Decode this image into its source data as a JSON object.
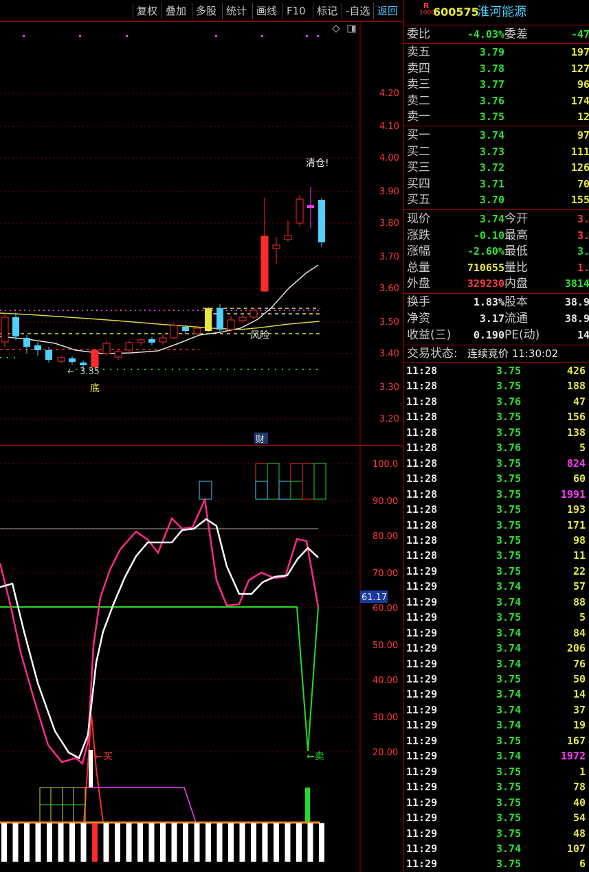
{
  "toolbar": {
    "buttons": [
      "复权",
      "叠加",
      "多股",
      "统计",
      "画线",
      "F10",
      "标记",
      "-自选",
      "返回"
    ]
  },
  "main_chart": {
    "price_axis": [
      "4.20",
      "4.10",
      "4.00",
      "3.90",
      "3.80",
      "3.70",
      "3.60",
      "3.50",
      "3.40",
      "3.30",
      "3.20"
    ],
    "indicator_axis": [
      "100.0",
      "90.00",
      "80.00",
      "70.00",
      "60.00",
      "50.00",
      "40.00",
      "30.00",
      "20.00"
    ],
    "labels": {
      "clear": "清仓!",
      "risk": "风险",
      "bottom": "底",
      "low_price": "3.35",
      "finance": "财",
      "buy": "买",
      "sell": "←卖",
      "current_indicator": "61.17"
    }
  },
  "quote": {
    "market_badge_top": "R",
    "market_badge_bottom": "1000",
    "code": "600575",
    "name": "淮河能源",
    "ratio_label": "委比",
    "ratio_value": "-4.03%",
    "diff_label": "委差",
    "diff_value": "-47",
    "asks": [
      {
        "label": "卖五",
        "price": "3.79",
        "vol": "197"
      },
      {
        "label": "卖四",
        "price": "3.78",
        "vol": "127"
      },
      {
        "label": "卖三",
        "price": "3.77",
        "vol": "96"
      },
      {
        "label": "卖二",
        "price": "3.76",
        "vol": "174"
      },
      {
        "label": "卖一",
        "price": "3.75",
        "vol": "12"
      }
    ],
    "bids": [
      {
        "label": "买一",
        "price": "3.74",
        "vol": "97"
      },
      {
        "label": "买二",
        "price": "3.73",
        "vol": "111"
      },
      {
        "label": "买三",
        "price": "3.72",
        "vol": "126"
      },
      {
        "label": "买四",
        "price": "3.71",
        "vol": "70"
      },
      {
        "label": "买五",
        "price": "3.70",
        "vol": "155"
      }
    ],
    "stats": [
      {
        "l1": "现价",
        "v1": "3.74",
        "c1": "green",
        "l2": "今开",
        "v2": "3.",
        "c2": "red"
      },
      {
        "l1": "涨跌",
        "v1": "-0.10",
        "c1": "green",
        "l2": "最高",
        "v2": "3.",
        "c2": "red"
      },
      {
        "l1": "涨幅",
        "v1": "-2.60%",
        "c1": "green",
        "l2": "最低",
        "v2": "3.",
        "c2": "green"
      },
      {
        "l1": "总量",
        "v1": "710655",
        "c1": "yellow",
        "l2": "量比",
        "v2": "1.",
        "c2": "red"
      },
      {
        "l1": "外盘",
        "v1": "329230",
        "c1": "red",
        "l2": "内盘",
        "v2": "3814",
        "c2": "green"
      }
    ],
    "fundamentals": [
      {
        "l1": "换手",
        "v1": "1.83%",
        "l2": "股本",
        "v2": "38.9"
      },
      {
        "l1": "净资",
        "v1": "3.17",
        "l2": "流通",
        "v2": "38.9"
      },
      {
        "l1": "收益(三)",
        "v1": "0.190",
        "l2": "PE(动)",
        "v2": "14"
      }
    ],
    "status_label": "交易状态:",
    "status_value": "连续竞价 11:30:02",
    "ticks": [
      {
        "t": "11:28",
        "p": "3.75",
        "v": "426",
        "pc": "green",
        "vc": "yellow"
      },
      {
        "t": "11:28",
        "p": "3.75",
        "v": "188",
        "pc": "green",
        "vc": "yellow"
      },
      {
        "t": "11:28",
        "p": "3.76",
        "v": "47",
        "pc": "green",
        "vc": "yellow"
      },
      {
        "t": "11:28",
        "p": "3.75",
        "v": "156",
        "pc": "green",
        "vc": "yellow"
      },
      {
        "t": "11:28",
        "p": "3.75",
        "v": "138",
        "pc": "green",
        "vc": "yellow"
      },
      {
        "t": "11:28",
        "p": "3.76",
        "v": "5",
        "pc": "green",
        "vc": "yellow"
      },
      {
        "t": "11:28",
        "p": "3.75",
        "v": "824",
        "pc": "green",
        "vc": "magenta"
      },
      {
        "t": "11:28",
        "p": "3.75",
        "v": "60",
        "pc": "green",
        "vc": "yellow"
      },
      {
        "t": "11:28",
        "p": "3.75",
        "v": "1991",
        "pc": "green",
        "vc": "magenta"
      },
      {
        "t": "11:28",
        "p": "3.75",
        "v": "193",
        "pc": "green",
        "vc": "yellow"
      },
      {
        "t": "11:28",
        "p": "3.75",
        "v": "171",
        "pc": "green",
        "vc": "yellow"
      },
      {
        "t": "11:28",
        "p": "3.75",
        "v": "98",
        "pc": "green",
        "vc": "yellow"
      },
      {
        "t": "11:28",
        "p": "3.75",
        "v": "11",
        "pc": "green",
        "vc": "yellow"
      },
      {
        "t": "11:29",
        "p": "3.75",
        "v": "22",
        "pc": "green",
        "vc": "yellow"
      },
      {
        "t": "11:29",
        "p": "3.74",
        "v": "57",
        "pc": "green",
        "vc": "yellow"
      },
      {
        "t": "11:29",
        "p": "3.74",
        "v": "88",
        "pc": "green",
        "vc": "yellow"
      },
      {
        "t": "11:29",
        "p": "3.75",
        "v": "5",
        "pc": "green",
        "vc": "yellow"
      },
      {
        "t": "11:29",
        "p": "3.74",
        "v": "84",
        "pc": "green",
        "vc": "yellow"
      },
      {
        "t": "11:29",
        "p": "3.74",
        "v": "206",
        "pc": "green",
        "vc": "yellow"
      },
      {
        "t": "11:29",
        "p": "3.74",
        "v": "76",
        "pc": "green",
        "vc": "yellow"
      },
      {
        "t": "11:29",
        "p": "3.75",
        "v": "50",
        "pc": "green",
        "vc": "yellow"
      },
      {
        "t": "11:29",
        "p": "3.74",
        "v": "14",
        "pc": "green",
        "vc": "yellow"
      },
      {
        "t": "11:29",
        "p": "3.74",
        "v": "37",
        "pc": "green",
        "vc": "yellow"
      },
      {
        "t": "11:29",
        "p": "3.74",
        "v": "19",
        "pc": "green",
        "vc": "yellow"
      },
      {
        "t": "11:29",
        "p": "3.75",
        "v": "167",
        "pc": "green",
        "vc": "yellow"
      },
      {
        "t": "11:29",
        "p": "3.74",
        "v": "1972",
        "pc": "green",
        "vc": "magenta"
      },
      {
        "t": "11:29",
        "p": "3.75",
        "v": "1",
        "pc": "green",
        "vc": "yellow"
      },
      {
        "t": "11:29",
        "p": "3.75",
        "v": "78",
        "pc": "green",
        "vc": "yellow"
      },
      {
        "t": "11:29",
        "p": "3.75",
        "v": "40",
        "pc": "green",
        "vc": "yellow"
      },
      {
        "t": "11:29",
        "p": "3.75",
        "v": "54",
        "pc": "green",
        "vc": "yellow"
      },
      {
        "t": "11:29",
        "p": "3.75",
        "v": "48",
        "pc": "green",
        "vc": "yellow"
      },
      {
        "t": "11:29",
        "p": "3.74",
        "v": "107",
        "pc": "green",
        "vc": "yellow"
      },
      {
        "t": "11:29",
        "p": "3.75",
        "v": "6",
        "pc": "green",
        "vc": "yellow"
      }
    ]
  },
  "colors": {
    "up": "#ff2a2a",
    "down": "#4fd0ff",
    "grid": "#8a0000",
    "k_line": "#ff2a8a",
    "d_line": "#ffffff",
    "signal_line": "#22dd22",
    "ma_yellow": "#d8d840"
  }
}
